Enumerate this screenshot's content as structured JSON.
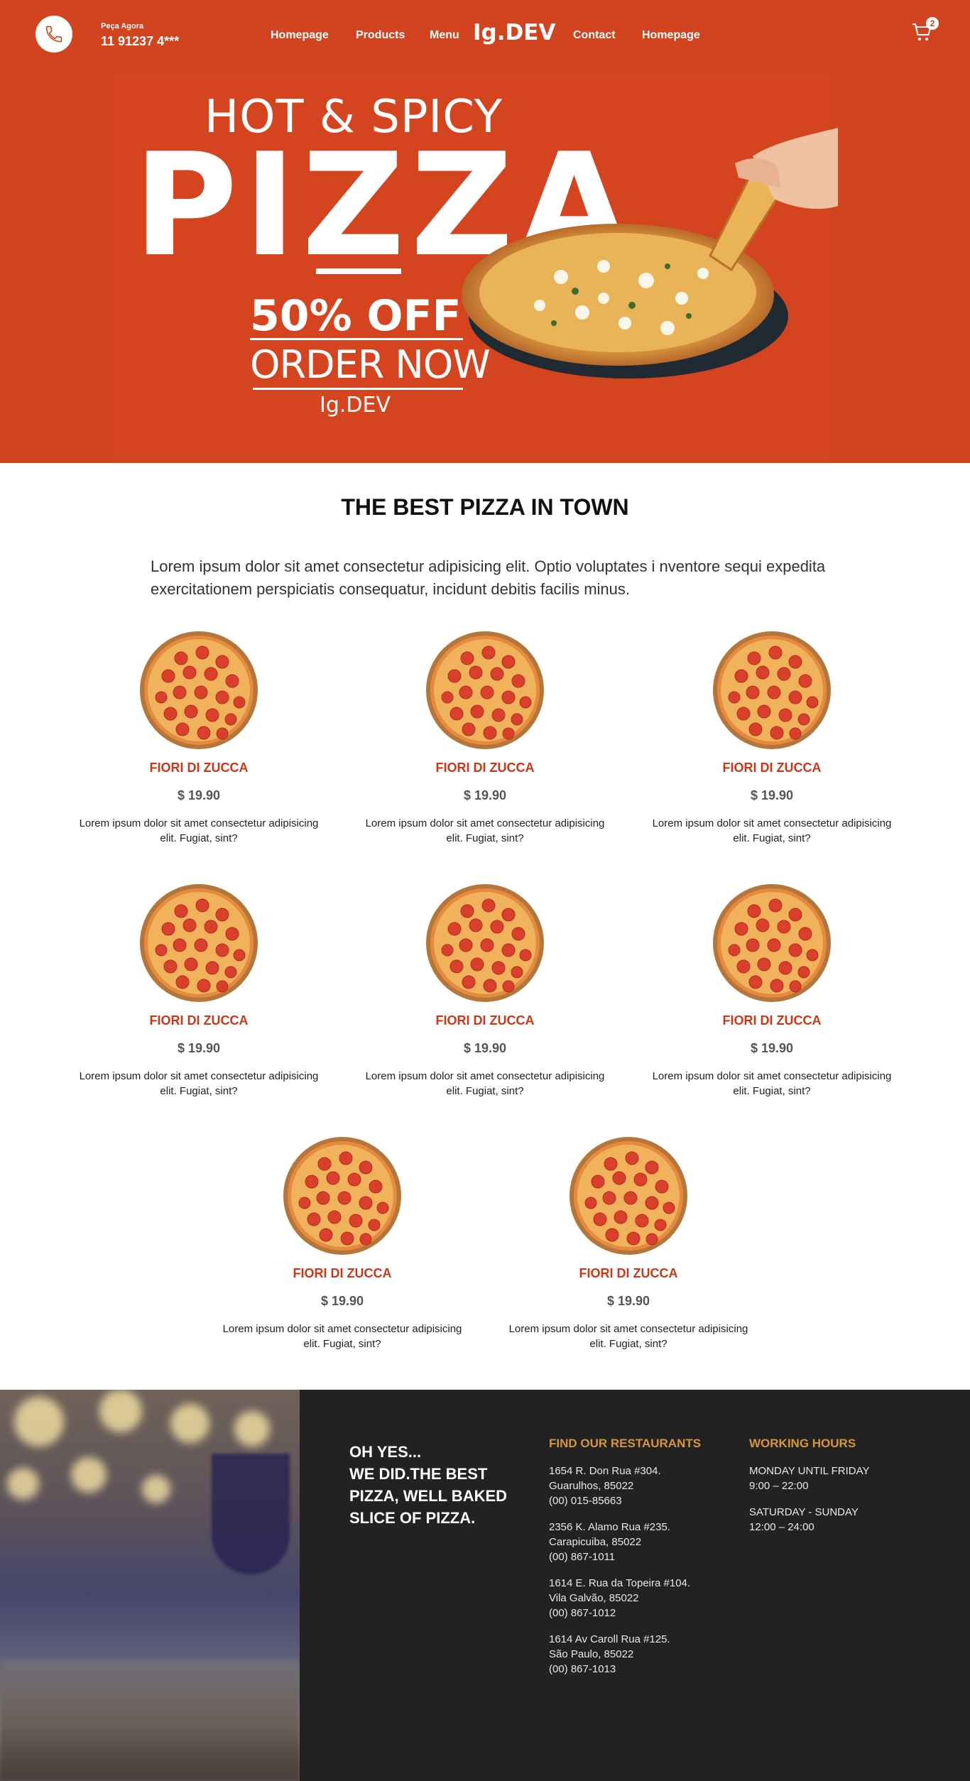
{
  "header": {
    "call_label": "Peça Agora",
    "phone": "11 91237 4***",
    "nav": [
      "Homepage",
      "Products",
      "Menu",
      "Contact",
      "Homepage"
    ],
    "logo": "Ig.DEV",
    "cart_count": "2"
  },
  "hero": {
    "tagline": "HOT & SPICY",
    "headline": "PIZZA",
    "discount": "50% OFF",
    "cta": "ORDER NOW",
    "brand": "Ig.DEV"
  },
  "menu": {
    "title": "THE BEST PIZZA IN TOWN",
    "intro": "Lorem ipsum dolor sit amet consectetur adipisicing elit. Optio voluptates i nventore sequi expedita exercitationem perspiciatis consequatur, incidunt debitis facilis minus.",
    "items": [
      {
        "name": "FIORI DI ZUCCA",
        "price": "$ 19.90",
        "desc": "Lorem ipsum dolor sit amet consectetur adipisicing elit. Fugiat, sint?"
      },
      {
        "name": "FIORI DI ZUCCA",
        "price": "$ 19.90",
        "desc": "Lorem ipsum dolor sit amet consectetur adipisicing elit. Fugiat, sint?"
      },
      {
        "name": "FIORI DI ZUCCA",
        "price": "$ 19.90",
        "desc": "Lorem ipsum dolor sit amet consectetur adipisicing elit. Fugiat, sint?"
      },
      {
        "name": "FIORI DI ZUCCA",
        "price": "$ 19.90",
        "desc": "Lorem ipsum dolor sit amet consectetur adipisicing elit. Fugiat, sint?"
      },
      {
        "name": "FIORI DI ZUCCA",
        "price": "$ 19.90",
        "desc": "Lorem ipsum dolor sit amet consectetur adipisicing elit. Fugiat, sint?"
      },
      {
        "name": "FIORI DI ZUCCA",
        "price": "$ 19.90",
        "desc": "Lorem ipsum dolor sit amet consectetur adipisicing elit. Fugiat, sint?"
      },
      {
        "name": "FIORI DI ZUCCA",
        "price": "$ 19.90",
        "desc": "Lorem ipsum dolor sit amet consectetur adipisicing elit. Fugiat, sint?"
      },
      {
        "name": "FIORI DI ZUCCA",
        "price": "$ 19.90",
        "desc": "Lorem ipsum dolor sit amet consectetur adipisicing elit. Fugiat, sint?"
      }
    ]
  },
  "footer": {
    "slogan_lines": [
      "OH YES...",
      "WE DID.THE BEST",
      "PIZZA, WELL BAKED",
      "SLICE OF PIZZA."
    ],
    "restaurants_title": "FIND OUR RESTAURANTS",
    "restaurants": [
      [
        "1654 R. Don Rua #304.",
        "Guarulhos, 85022",
        "(00) 015-85663"
      ],
      [
        "2356 K. Alamo Rua #235.",
        "Carapicuiba, 85022",
        "(00) 867-1011"
      ],
      [
        "1614 E. Rua da Topeira #104.",
        "Vila Galvão, 85022",
        "(00) 867-1012"
      ],
      [
        "1614 Av Caroll Rua #125.",
        "São Paulo, 85022",
        "(00) 867-1013"
      ]
    ],
    "hours_title": "WORKING HOURS",
    "hours": [
      [
        "MONDAY UNTIL FRIDAY",
        "9:00 – 22:00"
      ],
      [
        "SATURDAY - SUNDAY",
        "12:00 – 24:00"
      ]
    ]
  },
  "colors": {
    "brand_red": "#d2441f",
    "item_name": "#c53a19",
    "footer_bg": "#222222",
    "footer_heading": "#d59637"
  },
  "icons": {
    "phone": "phone-icon",
    "cart": "cart-icon"
  }
}
